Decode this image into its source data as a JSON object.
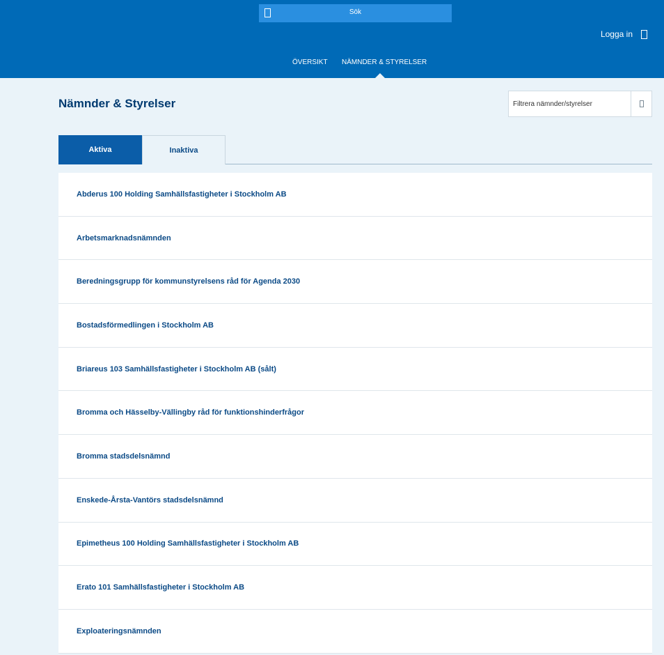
{
  "header": {
    "search_label": "Sök",
    "login_label": "Logga in",
    "nav": [
      {
        "label": "ÖVERSIKT"
      },
      {
        "label": "NÄMNDER & STYRELSER"
      }
    ]
  },
  "page": {
    "title": "Nämnder & Styrelser",
    "filter_placeholder": "Filtrera nämnder/styrelser"
  },
  "tabs": [
    {
      "label": "Aktiva",
      "active": true
    },
    {
      "label": "Inaktiva",
      "active": false
    }
  ],
  "items": [
    {
      "label": "Abderus 100 Holding Samhällsfastigheter i Stockholm AB"
    },
    {
      "label": "Arbetsmarknadsnämnden"
    },
    {
      "label": "Beredningsgrupp för kommunstyrelsens råd för Agenda 2030"
    },
    {
      "label": "Bostadsförmedlingen i Stockholm AB"
    },
    {
      "label": "Briareus 103 Samhällsfastigheter i Stockholm AB (sålt)"
    },
    {
      "label": "Bromma och Hässelby-Vällingby råd för funktionshinderfrågor"
    },
    {
      "label": "Bromma stadsdelsnämnd"
    },
    {
      "label": "Enskede-Årsta-Vantörs stadsdelsnämnd"
    },
    {
      "label": "Epimetheus 100 Holding Samhällsfastigheter i Stockholm AB"
    },
    {
      "label": "Erato 101 Samhällsfastigheter i Stockholm AB"
    },
    {
      "label": "Exploateringsnämnden"
    }
  ],
  "colors": {
    "header_bg": "#006ab7",
    "search_bg": "#2a8fe0",
    "page_bg": "#eaf3f9",
    "active_tab": "#0b5da8",
    "link_text": "#0b4a86"
  }
}
